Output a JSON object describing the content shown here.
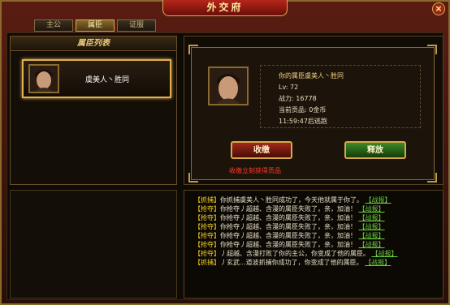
{
  "window": {
    "title": "外交府",
    "close": "×"
  },
  "tabs": [
    {
      "label": "主公",
      "active": false
    },
    {
      "label": "属臣",
      "active": true
    },
    {
      "label": "证服",
      "active": false
    }
  ],
  "subject_list": {
    "header": "属臣列表",
    "items": [
      {
        "name": "虞美人丶胜同",
        "selected": true
      }
    ]
  },
  "detail": {
    "title": "你的属臣虞美人丶胜同",
    "level": "Lv: 72",
    "power": "战力: 16778",
    "tribute": "当前贡品: 0金币",
    "escape": "11:59:47后逃跑"
  },
  "buttons": {
    "collect": "收缴",
    "release": "释放"
  },
  "hint": "收缴立刻获得贡品",
  "log": [
    {
      "tag": "【抓捕】",
      "text": "你抓捕虞美人丶胜同成功了，今天他就属于你了。",
      "link": "【战报】"
    },
    {
      "tag": "【抢夺】",
      "text": "你抢夺丿超越、含漫的属臣失败了，亲，加油！",
      "link": "【战报】"
    },
    {
      "tag": "【抢夺】",
      "text": "你抢夺丿超越、含漫的属臣失败了，亲，加油！",
      "link": "【战报】"
    },
    {
      "tag": "【抢夺】",
      "text": "你抢夺丿超越、含漫的属臣失败了，亲，加油！",
      "link": "【战报】"
    },
    {
      "tag": "【抢夺】",
      "text": "你抢夺丿超越、含漫的属臣失败了，亲，加油！",
      "link": "【战报】"
    },
    {
      "tag": "【抢夺】",
      "text": "你抢夺丿超越、含漫的属臣失败了，亲，加油！",
      "link": "【战报】"
    },
    {
      "tag": "【抢夺】",
      "text": "丿超越、含漫打败了你的主公，你变成了他的属臣。",
      "link": "【战报】"
    },
    {
      "tag": "【抓捕】",
      "text": "丿玄武...道波抓捕你成功了，你变成了他的属臣。",
      "link": "【战报】"
    }
  ],
  "colors": {
    "accent_gold": "#e0b050",
    "tag_yellow": "#f4d020",
    "link_green": "#6ad040",
    "hint_red": "#ff3a2a"
  }
}
